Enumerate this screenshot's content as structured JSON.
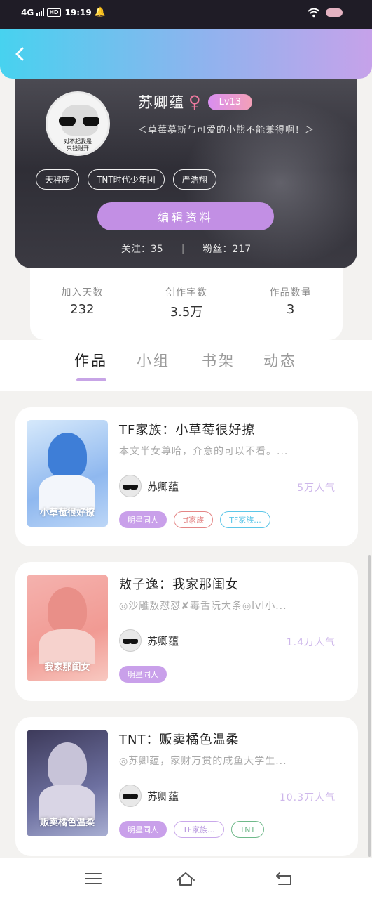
{
  "status_bar": {
    "network": "4G",
    "hd": "HD",
    "time": "19:19"
  },
  "profile": {
    "nickname": "苏卿蕴",
    "gender_symbol": "♀",
    "level": "Lv13",
    "signature": "＜草莓慕斯与可爱的小熊不能兼得啊！＞",
    "avatar_text": "对不起我是\n只钱财开",
    "tags": [
      "天秤座",
      "TNT时代少年团",
      "严浩翔"
    ],
    "edit_button": "编辑资料",
    "following": "关注：35",
    "separator": "|",
    "followers": "粉丝：217"
  },
  "stats": [
    {
      "label": "加入天数",
      "value": "232"
    },
    {
      "label": "创作字数",
      "value": "3.5万"
    },
    {
      "label": "作品数量",
      "value": "3"
    }
  ],
  "tabs": [
    {
      "label": "作品",
      "active": true
    },
    {
      "label": "小组",
      "active": false
    },
    {
      "label": "书架",
      "active": false
    },
    {
      "label": "动态",
      "active": false
    }
  ],
  "works": [
    {
      "title": "TF家族：小草莓很好撩",
      "desc": "本文半女尊哈，介意的可以不看。...",
      "author": "苏卿蕴",
      "popularity": "5万人气",
      "cover_text": "小草莓很好撩",
      "tags": [
        {
          "label": "明星同人",
          "style": "fill"
        },
        {
          "label": "tf家族",
          "style": "red"
        },
        {
          "label": "TF家族...",
          "style": "blue"
        }
      ]
    },
    {
      "title": "敖子逸：我家那闺女",
      "desc": "◎沙雕敖怼怼✘毒舌阮大条◎lvl小...",
      "author": "苏卿蕴",
      "popularity": "1.4万人气",
      "cover_text": "我家那闺女",
      "tags": [
        {
          "label": "明星同人",
          "style": "fill"
        }
      ]
    },
    {
      "title": "TNT：贩卖橘色温柔",
      "desc": "◎苏卿蕴，家财万贯的咸鱼大学生...",
      "author": "苏卿蕴",
      "popularity": "10.3万人气",
      "cover_text": "贩卖橘色温柔",
      "tags": [
        {
          "label": "明星同人",
          "style": "fill"
        },
        {
          "label": "TF家族...",
          "style": "lav"
        },
        {
          "label": "TNT",
          "style": "green"
        }
      ]
    }
  ]
}
